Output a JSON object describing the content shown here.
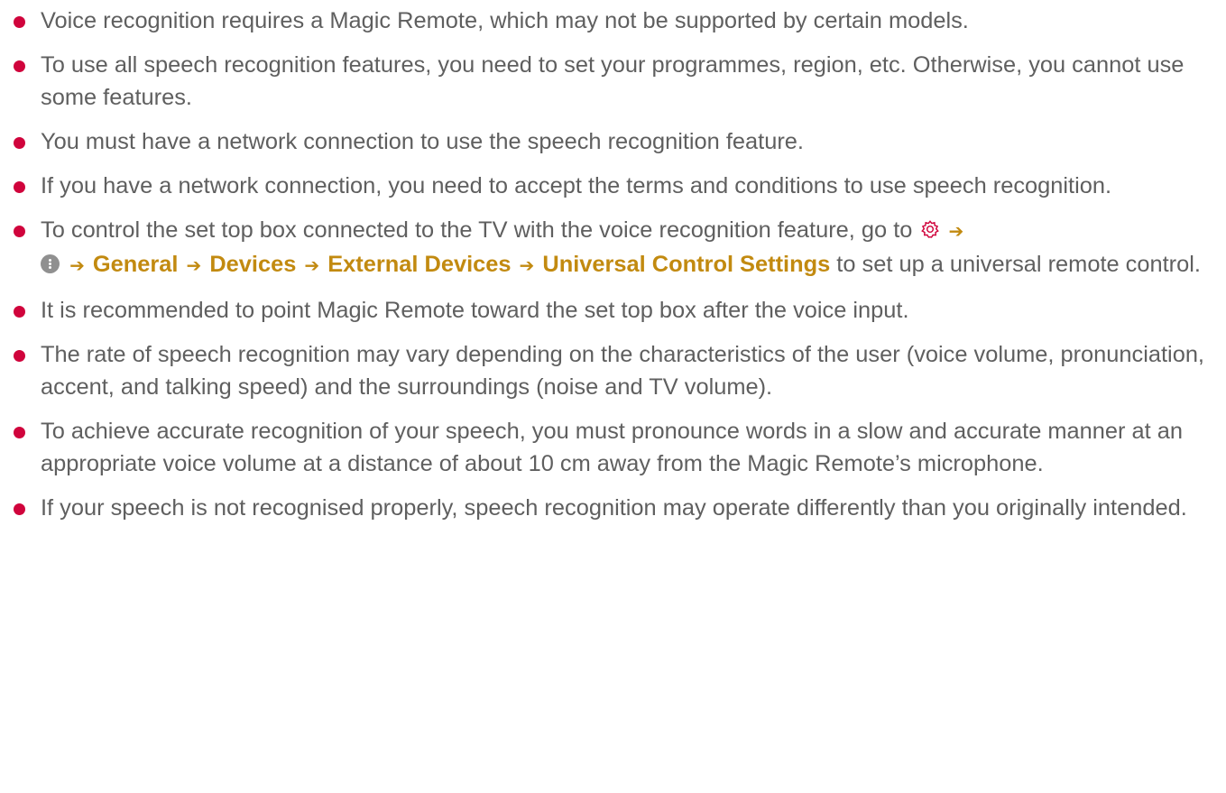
{
  "notes": [
    {
      "text": "Voice recognition requires a Magic Remote, which may not be supported by certain models."
    },
    {
      "text": "To use all speech recognition features, you need to set your programmes, region, etc. Otherwise, you cannot use some features."
    },
    {
      "text": "You must have a network connection to use the speech recognition feature."
    },
    {
      "text": "If you have a network connection, you need to accept the terms and conditions to use speech recognition."
    },
    {
      "lead": "To control the set top box connected to the TV with the voice recognition feature, go to",
      "path": [
        "General",
        "Devices",
        "External Devices",
        "Universal Control Settings"
      ],
      "tail": "to set up a universal remote control."
    },
    {
      "text": "It is recommended to point Magic Remote toward the set top box after the voice input."
    },
    {
      "text": "The rate of speech recognition may vary depending on the characteristics of the user (voice volume, pronunciation, accent, and talking speed) and the surroundings (noise and TV volume)."
    },
    {
      "text": "To achieve accurate recognition of your speech, you must pronounce words in a slow and accurate manner at an appropriate voice volume at a distance of about 10 cm away from the Magic Remote’s microphone."
    },
    {
      "text": "If your speech is not recognised properly, speech recognition may operate differently than you originally intended."
    }
  ],
  "icons": {
    "settings": "gear-icon",
    "more": "more-options-icon",
    "arrow": "right-arrow-icon"
  },
  "colors": {
    "bullet": "#d0043c",
    "path_text": "#c28a10",
    "body_text": "#5f5f5f",
    "more_icon": "#909090"
  }
}
